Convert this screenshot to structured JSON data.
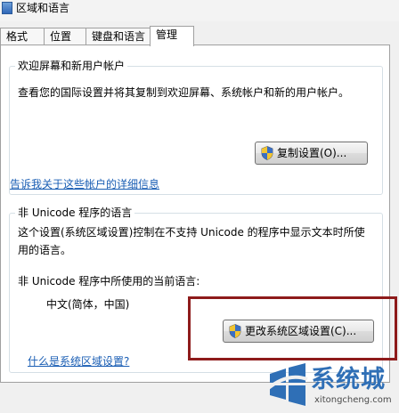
{
  "window": {
    "title": "区域和语言"
  },
  "tabs": [
    {
      "label": "格式"
    },
    {
      "label": "位置"
    },
    {
      "label": "键盘和语言"
    },
    {
      "label": "管理"
    }
  ],
  "welcome_group": {
    "title": "欢迎屏幕和新用户帐户",
    "description": "查看您的国际设置并将其复制到欢迎屏幕、系统帐户和新的用户帐户。",
    "copy_button": "复制设置(O)...",
    "link": "告诉我关于这些帐户的详细信息"
  },
  "unicode_group": {
    "title": "非 Unicode 程序的语言",
    "description_line1": "这个设置(系统区域设置)控制在不支持 Unicode 的程序中显示文本时所使",
    "description_line2": "用的语言。",
    "current_label": "非 Unicode 程序中所使用的当前语言:",
    "current_value": "中文(简体，中国)",
    "change_button": "更改系统区域设置(C)...",
    "link": "什么是系统区域设置?"
  },
  "watermark": {
    "text": "系统城",
    "url": "xitongcheng.com"
  }
}
